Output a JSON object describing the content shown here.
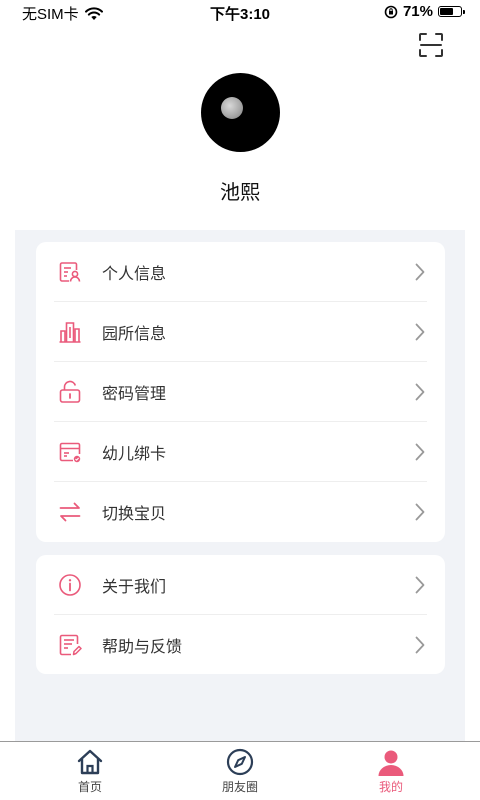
{
  "status_bar": {
    "carrier": "无SIM卡",
    "time": "下午3:10",
    "battery_percent": "71%",
    "battery_level": 0.71
  },
  "profile": {
    "name": "池熙"
  },
  "menu_groups": [
    {
      "items": [
        {
          "label": "个人信息",
          "icon": "id-card-icon"
        },
        {
          "label": "园所信息",
          "icon": "buildings-icon"
        },
        {
          "label": "密码管理",
          "icon": "lock-icon"
        },
        {
          "label": "幼儿绑卡",
          "icon": "card-icon"
        },
        {
          "label": "切换宝贝",
          "icon": "switch-arrows-icon"
        }
      ]
    },
    {
      "items": [
        {
          "label": "关于我们",
          "icon": "info-icon"
        },
        {
          "label": "帮助与反馈",
          "icon": "feedback-icon"
        }
      ]
    }
  ],
  "tab_bar": {
    "tabs": [
      {
        "label": "首页",
        "icon": "home-icon",
        "active": false
      },
      {
        "label": "朋友圈",
        "icon": "compass-icon",
        "active": false
      },
      {
        "label": "我的",
        "icon": "user-icon",
        "active": true
      }
    ]
  },
  "colors": {
    "accent": "#ea5a7b",
    "background": "#f1f3f7",
    "card": "#ffffff"
  }
}
